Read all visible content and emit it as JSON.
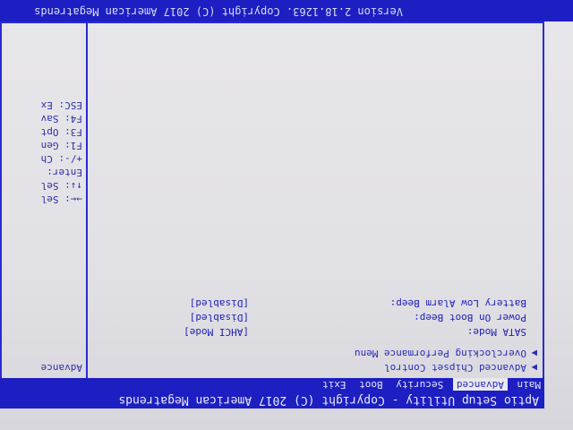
{
  "header": {
    "title": "Aptio Setup Utility - Copyright (C) 2017 American Megatrends"
  },
  "tabs": [
    {
      "label": "Main",
      "active": false
    },
    {
      "label": "Advanced",
      "active": true
    },
    {
      "label": "Security",
      "active": false
    },
    {
      "label": "Boot",
      "active": false
    },
    {
      "label": "Exit",
      "active": false
    }
  ],
  "menu": {
    "items": [
      {
        "label": "Advanced Chipset Control",
        "submenu": true
      },
      {
        "label": "Overclocking Performance Menu",
        "submenu": true
      }
    ],
    "settings": [
      {
        "label": "SATA Mode:",
        "value": "[AHCI Mode]"
      },
      {
        "label": "Power On Boot Beep:",
        "value": "[Disabled]"
      },
      {
        "label": "Battery Low Alarm Beep:",
        "value": "[Disabled]"
      }
    ]
  },
  "side": {
    "title": "Advance"
  },
  "help": [
    "→←: Sel",
    "↑↓: Sel",
    "Enter:",
    "+/-: Ch",
    "F1: Gen",
    "F3: Opt",
    "F4: Sav",
    "ESC: Ex"
  ],
  "footer": {
    "version": "Version 2.18.1263. Copyright (C) 2017 American Megatrends"
  },
  "colors": {
    "bios_blue": "#1d1fc2",
    "screen_bg": "#e2e1e5"
  }
}
